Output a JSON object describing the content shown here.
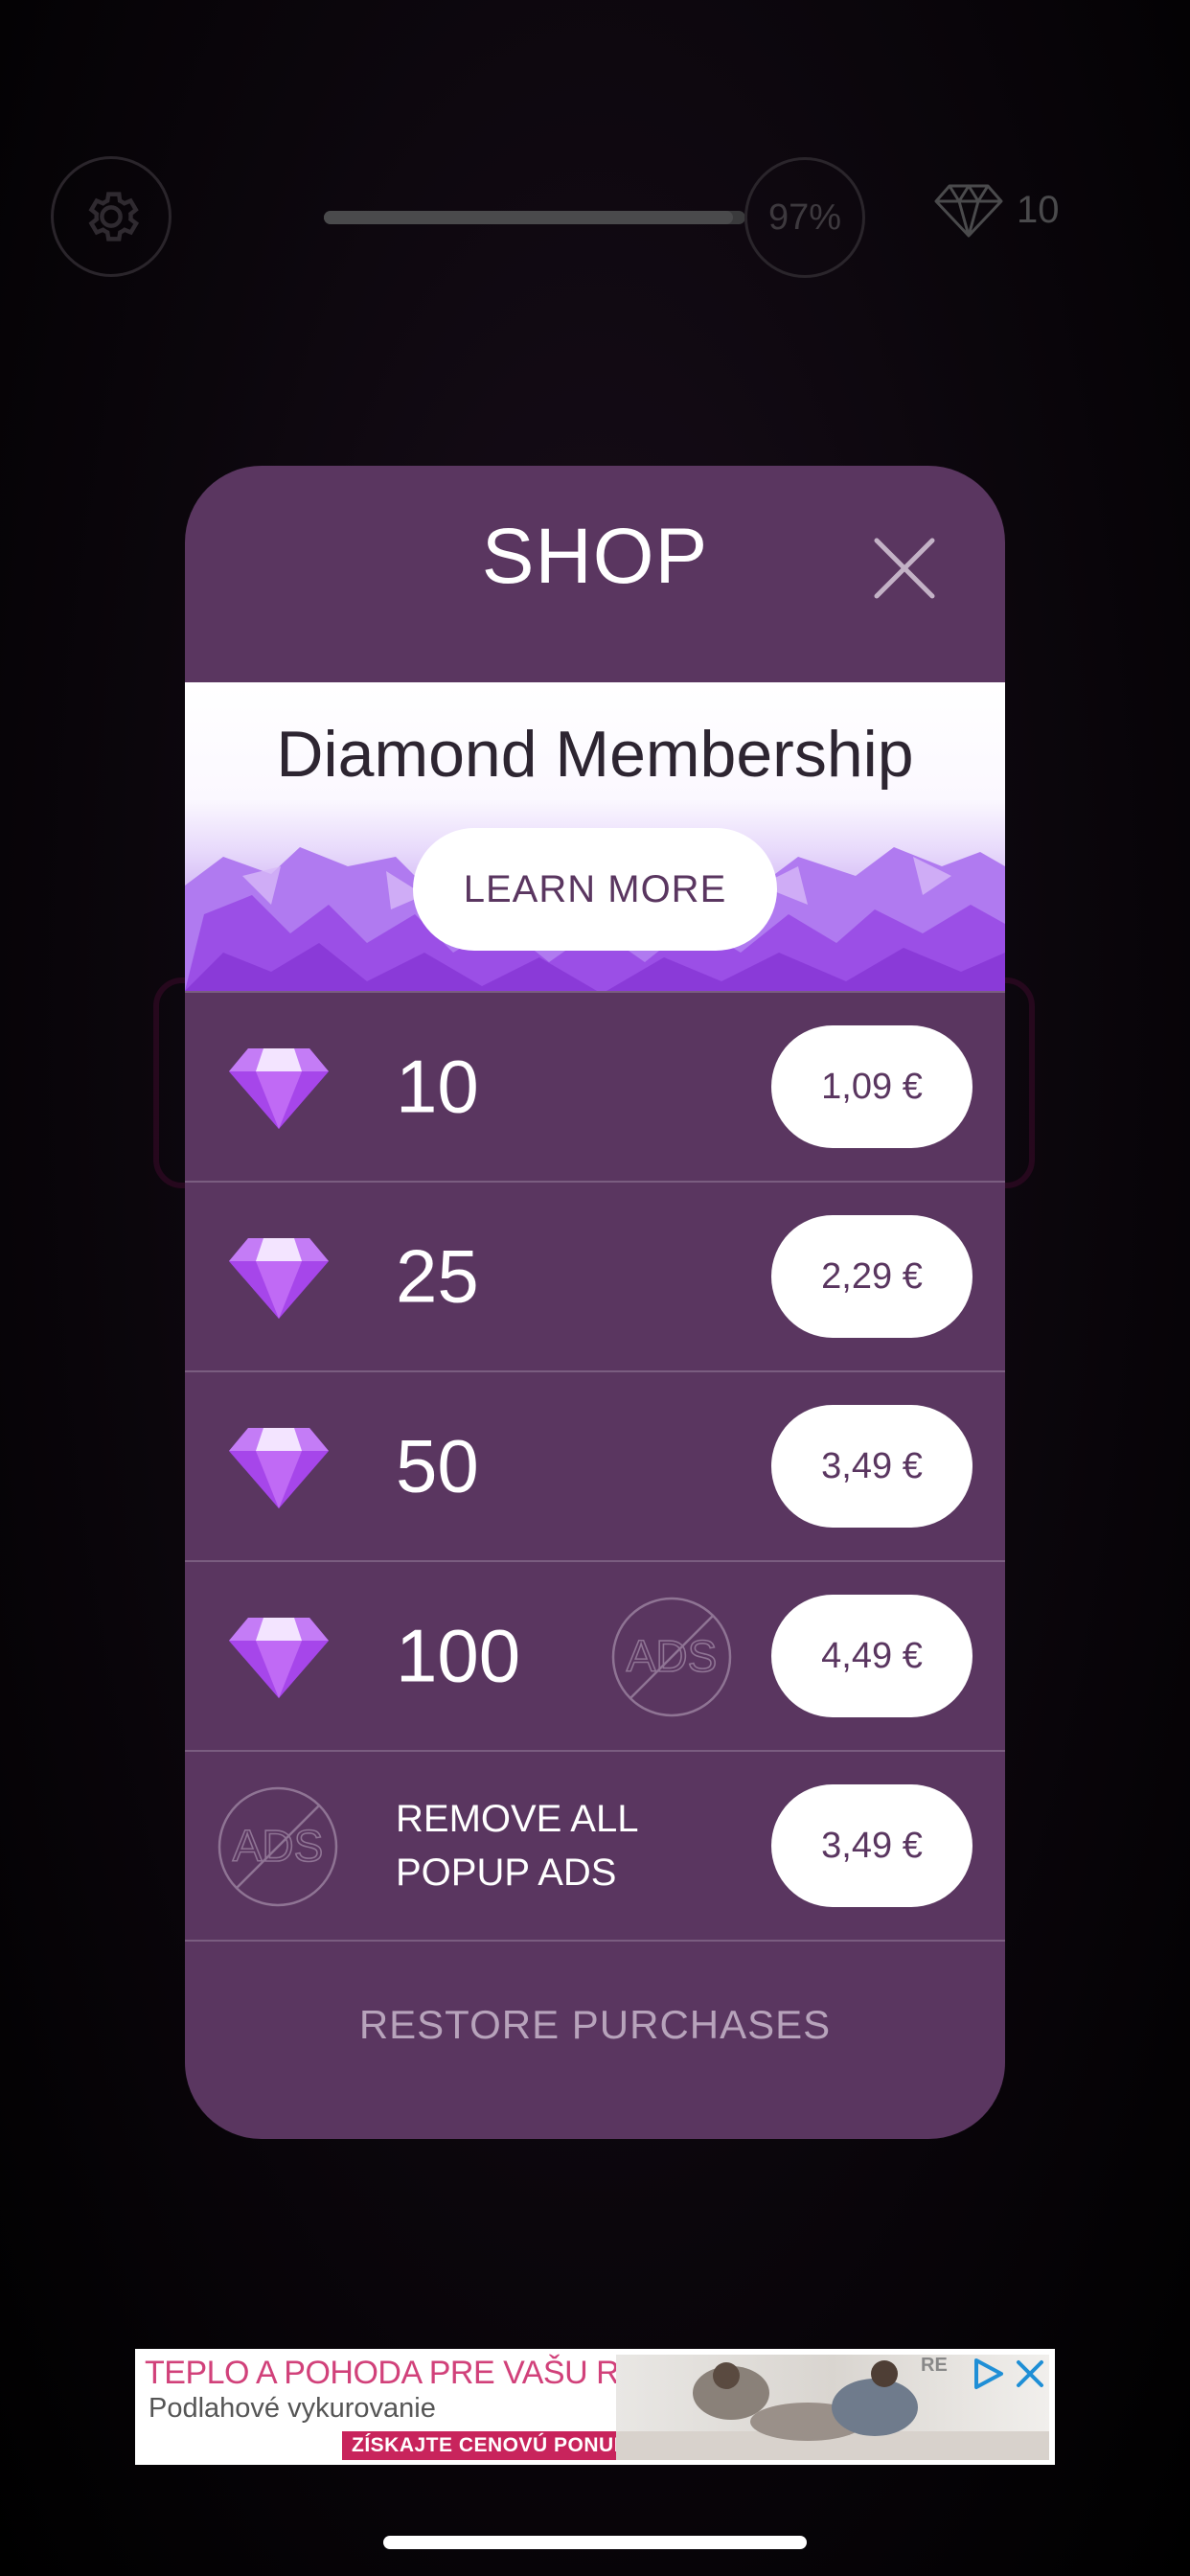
{
  "hud": {
    "progress_label": "97%",
    "progress_value": 0.97,
    "diamond_count": "10"
  },
  "shop": {
    "title": "SHOP",
    "membership": {
      "title": "Diamond Membership",
      "button_label": "LEARN MORE"
    },
    "packages": [
      {
        "quantity": "10",
        "price": "1,09 €",
        "no_ads_badge": false
      },
      {
        "quantity": "25",
        "price": "2,29 €",
        "no_ads_badge": false
      },
      {
        "quantity": "50",
        "price": "3,49 €",
        "no_ads_badge": false
      },
      {
        "quantity": "100",
        "price": "4,49 €",
        "no_ads_badge": true
      }
    ],
    "remove_ads": {
      "line1": "REMOVE ALL",
      "line2": "POPUP ADS",
      "price": "3,49 €",
      "badge_text": "ADS"
    },
    "restore_label": "RESTORE PURCHASES"
  },
  "ad": {
    "headline": "TEPLO A POHODA PRE VAŠU RODINU",
    "subline": "Podlahové vykurovanie",
    "cta": "ZÍSKAJTE CENOVÚ PONUKU ›",
    "brand": "RE"
  },
  "colors": {
    "modal_bg": "#5a3660",
    "accent_purple": "#a855f7",
    "price_text": "#5a3660",
    "ad_pink": "#c8245c"
  }
}
